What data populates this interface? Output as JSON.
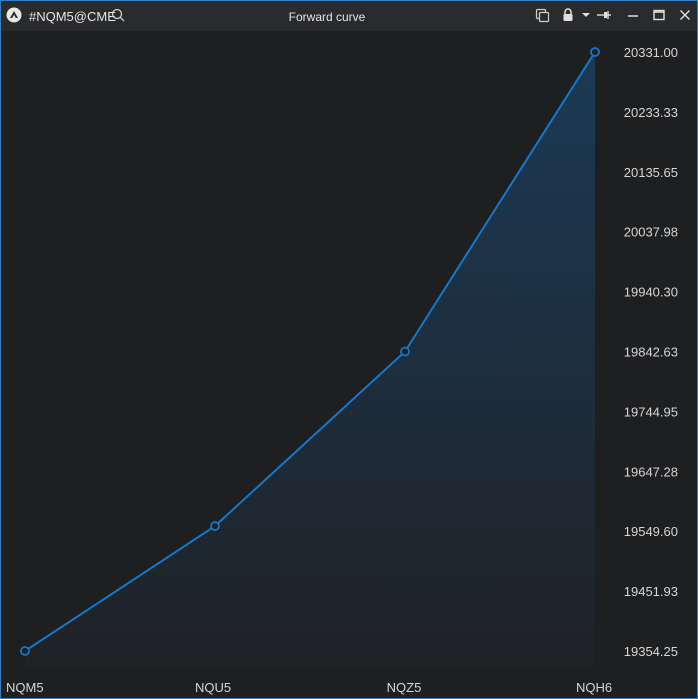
{
  "window": {
    "symbol": "#NQM5@CME",
    "title": "Forward curve"
  },
  "colors": {
    "line": "#1777c9",
    "fill_top": "#1b3a56",
    "fill_bottom": "#1f2226",
    "background": "#1e1f21",
    "titlebar": "#2a2b2e",
    "border": "#2f7fc9"
  },
  "icons": [
    "app-logo-icon",
    "search-icon",
    "copy-icon",
    "lock-icon",
    "dropdown-arrow-icon",
    "pin-icon",
    "minimize-icon",
    "maximize-icon",
    "close-icon"
  ],
  "chart_data": {
    "type": "area",
    "categories": [
      "NQM5",
      "NQU5",
      "NQZ5",
      "NQH6"
    ],
    "values": [
      19354.25,
      19558.0,
      19842.63,
      20331.0
    ],
    "y_ticks": [
      "20331.00",
      "20233.33",
      "20135.65",
      "20037.98",
      "19940.30",
      "19842.63",
      "19744.95",
      "19647.28",
      "19549.60",
      "19451.93",
      "19354.25"
    ],
    "ylim": [
      19354.25,
      20331.0
    ],
    "grid": false,
    "markers": "circle"
  }
}
